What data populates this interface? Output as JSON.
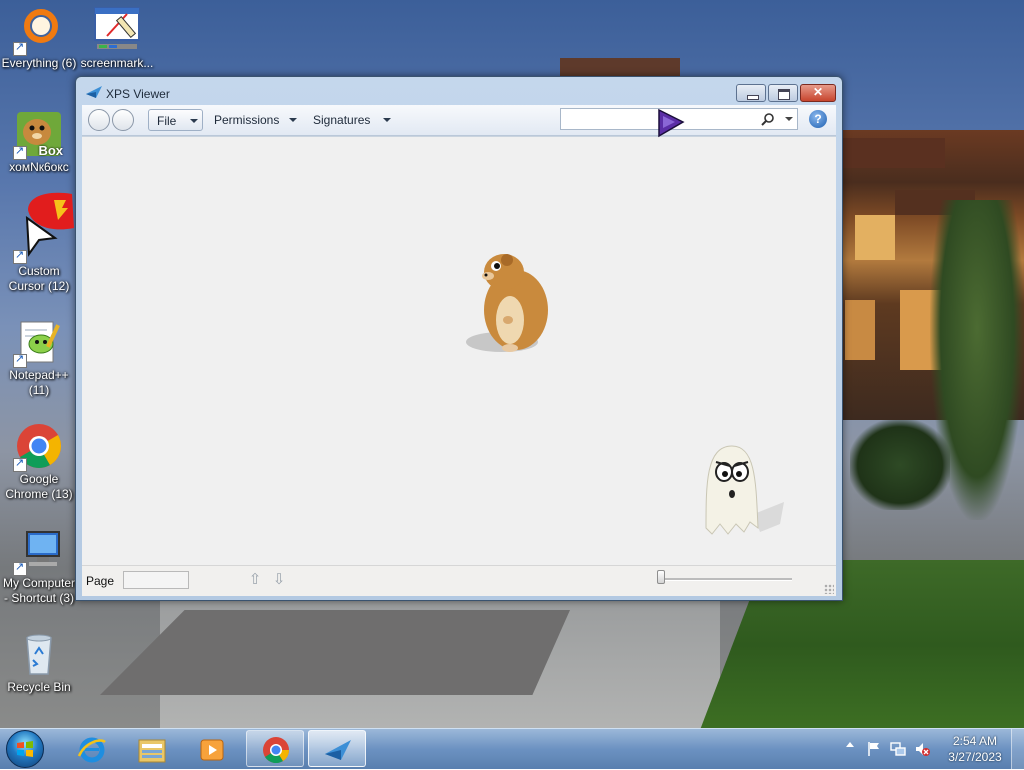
{
  "desktop": {
    "icons": [
      {
        "label": "Everything (6)",
        "icon": "everything-icon"
      },
      {
        "label": "screenmark...",
        "icon": "screenmarker-icon"
      },
      {
        "label": "хомNк6окс",
        "icon": "hamster-box-icon",
        "badge": "Box"
      },
      {
        "label": "Custom Cursor (12)",
        "icon": "custom-cursor-icon"
      },
      {
        "label": "Notepad++ (11)",
        "icon": "notepad-plus-plus-icon"
      },
      {
        "label": "Google Chrome (13)",
        "icon": "chrome-icon"
      },
      {
        "label": "My Computer - Shortcut (3)",
        "icon": "my-computer-icon"
      },
      {
        "label": "Recycle Bin",
        "icon": "recycle-bin-icon"
      }
    ]
  },
  "window": {
    "title": "XPS Viewer",
    "toolbar": {
      "file": "File",
      "permissions": "Permissions",
      "signatures": "Signatures",
      "search_value": "",
      "help": "?"
    },
    "status": {
      "page_label": "Page",
      "page_value": ""
    }
  },
  "taskbar": {
    "items": [
      {
        "name": "internet-explorer",
        "icon": "ie-icon",
        "state": "pinned"
      },
      {
        "name": "windows-explorer",
        "icon": "folder-icon",
        "state": "pinned"
      },
      {
        "name": "media-player",
        "icon": "media-player-icon",
        "state": "pinned"
      },
      {
        "name": "google-chrome",
        "icon": "chrome-icon",
        "state": "running"
      },
      {
        "name": "xps-viewer",
        "icon": "xps-icon",
        "state": "active"
      }
    ],
    "clock": {
      "time": "2:54 AM",
      "date": "3/27/2023"
    }
  },
  "colors": {
    "taskbar": "#6a95c5",
    "window_frame": "#b9cde5",
    "document_bg": "#f0f0f0",
    "close_button": "#c7452e"
  }
}
